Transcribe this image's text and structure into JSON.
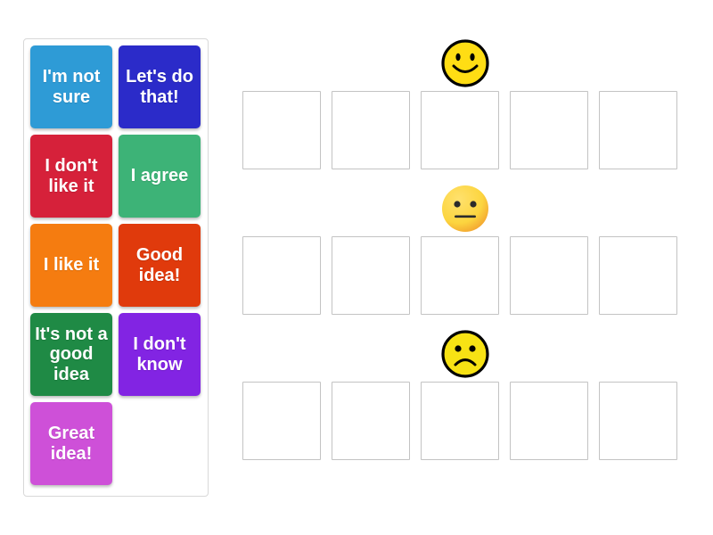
{
  "activity": {
    "type": "drag-and-drop-sorting",
    "background_color": "#ffffff"
  },
  "card_panel": {
    "name": "word-bank",
    "border_color": "#d8d8d8",
    "cards": [
      {
        "label": "I'm not sure",
        "color": "#2e9bd6",
        "name": "card-im-not-sure"
      },
      {
        "label": "Let's do that!",
        "color": "#2b2bc9",
        "name": "card-lets-do-that"
      },
      {
        "label": "I don't like it",
        "color": "#d6213a",
        "name": "card-i-dont-like-it"
      },
      {
        "label": "I agree",
        "color": "#3db377",
        "name": "card-i-agree"
      },
      {
        "label": "I like it",
        "color": "#f57c10",
        "name": "card-i-like-it"
      },
      {
        "label": "Good idea!",
        "color": "#e03a0c",
        "name": "card-good-idea"
      },
      {
        "label": "It's not a good idea",
        "color": "#1f8a45",
        "name": "card-its-not-a-good-idea"
      },
      {
        "label": "I don't know",
        "color": "#8224e3",
        "name": "card-i-dont-know"
      },
      {
        "label": "Great idea!",
        "color": "#ce50d8",
        "name": "card-great-idea"
      }
    ]
  },
  "answer_area": {
    "slot_border_color": "#c3c3c3",
    "rows": [
      {
        "face": "smiling-face",
        "face_label": "smiling face",
        "face_color": "#ffdd14",
        "slot_count": 5,
        "slots": [
          "",
          "",
          "",
          "",
          ""
        ]
      },
      {
        "face": "neutral-face",
        "face_label": "neutral face",
        "face_color": "#fcd53f",
        "slot_count": 5,
        "slots": [
          "",
          "",
          "",
          "",
          ""
        ]
      },
      {
        "face": "frowning-face",
        "face_label": "frowning face",
        "face_color": "#f7e214",
        "slot_count": 5,
        "slots": [
          "",
          "",
          "",
          "",
          ""
        ]
      }
    ]
  }
}
